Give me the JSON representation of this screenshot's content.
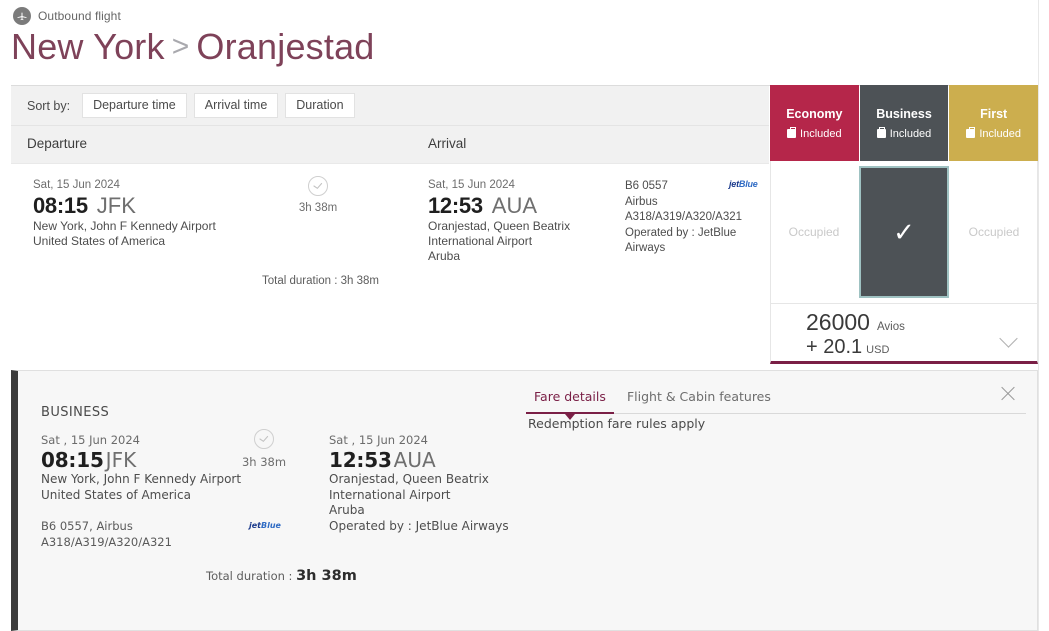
{
  "header": {
    "outbound_label": "Outbound flight",
    "plane_icon": "plane-icon",
    "origin_city": "New York",
    "arrow": ">",
    "destination_city": "Oranjestad"
  },
  "sort": {
    "label": "Sort by:",
    "options": [
      "Departure time",
      "Arrival time",
      "Duration"
    ]
  },
  "columns": {
    "departure": "Departure",
    "arrival": "Arrival"
  },
  "flight": {
    "departure": {
      "date": "Sat, 15 Jun 2024",
      "time": "08:15",
      "code": "JFK",
      "airport": "New York, John F Kennedy Airport",
      "country": "United States of America"
    },
    "arrival": {
      "date": "Sat, 15 Jun 2024",
      "time": "12:53",
      "code": "AUA",
      "airport_line1": "Oranjestad, Queen Beatrix",
      "airport_line2": "International Airport",
      "country": "Aruba"
    },
    "duration": "3h 38m",
    "duration_icon": "clock-icon",
    "total_duration_label": "Total duration : 3h 38m",
    "meta": {
      "number": "B6 0557",
      "aircraft_make": "Airbus",
      "aircraft_models": "A318/A319/A320/A321",
      "operated_by": "Operated by : JetBlue Airways"
    },
    "carrier_logo": {
      "prefix": "jet",
      "suffix": "Blue"
    }
  },
  "cabins": [
    {
      "name": "Economy",
      "included_label": "Included",
      "bag_icon": "baggage-icon",
      "color": "#b5264a",
      "state": "Occupied",
      "selected": false
    },
    {
      "name": "Business",
      "included_label": "Included",
      "bag_icon": "baggage-icon",
      "color": "#4d5256",
      "state": "",
      "selected": true
    },
    {
      "name": "First",
      "included_label": "Included",
      "bag_icon": "baggage-icon",
      "color": "#ccae4e",
      "state": "Occupied",
      "selected": false
    }
  ],
  "price": {
    "avios_amount": "26000",
    "avios_unit": "Avios",
    "cash_amount": "+ 20.1",
    "cash_currency": "USD",
    "expand_icon": "chevron-down-icon"
  },
  "detail": {
    "cabin_name": "BUSINESS",
    "tabs": [
      {
        "label": "Fare details",
        "active": true
      },
      {
        "label": "Flight & Cabin features",
        "active": false
      }
    ],
    "tab_content": "Redemption fare rules apply",
    "close_icon": "close-icon",
    "departure": {
      "date": "Sat , 15 Jun 2024",
      "time": "08:15",
      "code": "JFK",
      "airport": "New York, John F Kennedy Airport",
      "country": "United States of America"
    },
    "arrival": {
      "date": "Sat , 15 Jun 2024",
      "time": "12:53",
      "code": "AUA",
      "airport_line1": "Oranjestad, Queen Beatrix",
      "airport_line2": "International Airport",
      "country": "Aruba",
      "operated_by": "Operated by : JetBlue Airways"
    },
    "duration": "3h 38m",
    "duration_icon": "clock-icon",
    "meta_line1": "B6 0557, Airbus",
    "meta_line2": "A318/A319/A320/A321",
    "total_duration_label": "Total duration :",
    "total_duration_value": "3h 38m",
    "carrier_logo": {
      "prefix": "jet",
      "suffix": "Blue"
    }
  },
  "theme": {
    "brand_purple": "#7a1f46",
    "title_color": "#7e4259",
    "economy": "#b5264a",
    "business": "#4d5256",
    "first": "#ccae4e"
  }
}
